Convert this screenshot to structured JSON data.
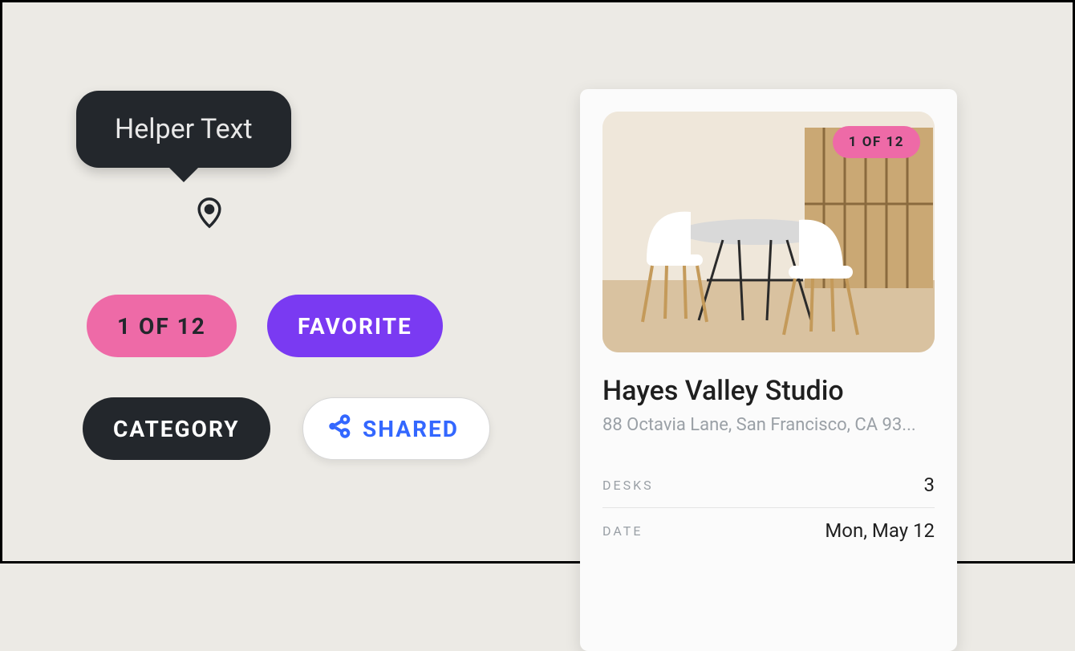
{
  "tooltip": {
    "text": "Helper Text"
  },
  "chips": {
    "count": "1 OF 12",
    "favorite": "FAVORITE",
    "category": "CATEGORY",
    "shared": "SHARED"
  },
  "card": {
    "photo_badge": "1 OF 12",
    "title": "Hayes Valley Studio",
    "address": "88 Octavia Lane, San Francisco, CA 93...",
    "rows": [
      {
        "label": "DESKS",
        "value": "3"
      },
      {
        "label": "DATE",
        "value": "Mon, May 12"
      }
    ]
  }
}
